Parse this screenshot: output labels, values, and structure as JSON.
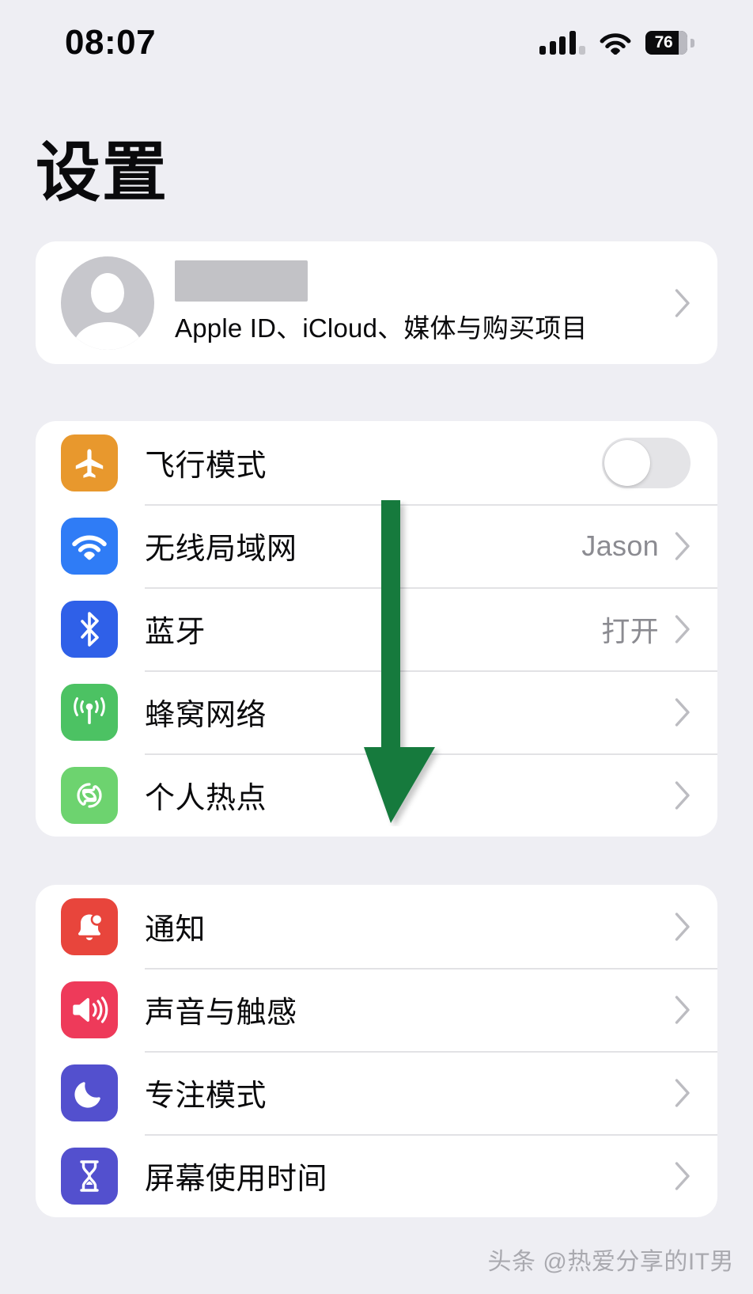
{
  "status_bar": {
    "time": "08:07",
    "battery_level": "76",
    "signal_icon": "cellular-signal-icon",
    "wifi_icon": "wifi-icon",
    "battery_icon": "battery-icon"
  },
  "header": {
    "title": "设置"
  },
  "account": {
    "name_redacted": true,
    "subtitle": "Apple ID、iCloud、媒体与购买项目",
    "avatar_icon": "person-avatar-icon",
    "chevron_icon": "chevron-right-icon"
  },
  "groups": [
    {
      "name": "connectivity",
      "rows": [
        {
          "label": "飞行模式",
          "icon": "airplane-icon",
          "icon_color": "#E8982D",
          "accessory": "toggle",
          "toggle_on": false,
          "value": ""
        },
        {
          "label": "无线局域网",
          "icon": "wifi-icon",
          "icon_color": "#2F7CF6",
          "accessory": "chevron",
          "value": "Jason"
        },
        {
          "label": "蓝牙",
          "icon": "bluetooth-icon",
          "icon_color": "#2F60E8",
          "accessory": "chevron",
          "value": "打开"
        },
        {
          "label": "蜂窝网络",
          "icon": "cellular-icon",
          "icon_color": "#4CC263",
          "accessory": "chevron",
          "value": ""
        },
        {
          "label": "个人热点",
          "icon": "personal-hotspot-icon",
          "icon_color": "#6DD36F",
          "accessory": "chevron",
          "value": ""
        }
      ]
    },
    {
      "name": "notifications-and-display",
      "rows": [
        {
          "label": "通知",
          "icon": "bell-icon",
          "icon_color": "#E8453C",
          "accessory": "chevron",
          "value": ""
        },
        {
          "label": "声音与触感",
          "icon": "speaker-icon",
          "icon_color": "#EE3A5A",
          "accessory": "chevron",
          "value": ""
        },
        {
          "label": "专注模式",
          "icon": "moon-icon",
          "icon_color": "#5350CE",
          "accessory": "chevron",
          "value": ""
        },
        {
          "label": "屏幕使用时间",
          "icon": "hourglass-icon",
          "icon_color": "#5350CE",
          "accessory": "chevron",
          "value": ""
        }
      ]
    }
  ],
  "annotation": {
    "arrow_icon": "down-arrow-annotation",
    "color": "#127A3E"
  },
  "watermark": {
    "text": "头条 @热爱分享的IT男"
  }
}
